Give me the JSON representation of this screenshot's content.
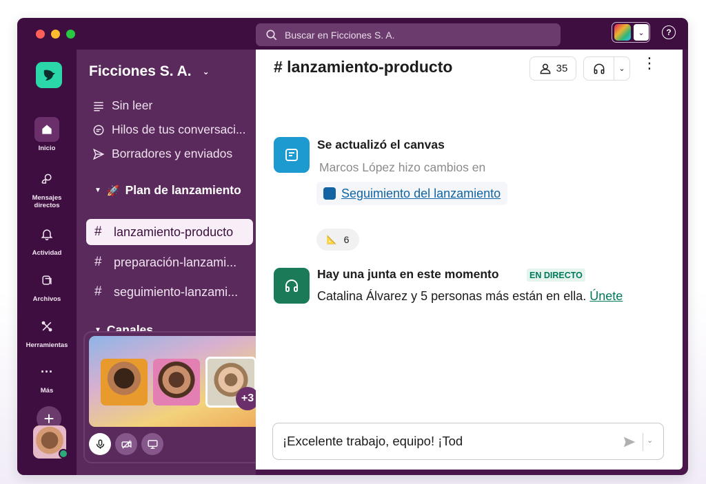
{
  "titlebar": {
    "search_placeholder": "Buscar en Ficciones S. A.",
    "help_label": "?"
  },
  "rail": {
    "items": [
      {
        "label": "Inicio",
        "icon": "home-icon"
      },
      {
        "label": "Mensajes directos",
        "icon": "dm-icon"
      },
      {
        "label": "Actividad",
        "icon": "bell-icon"
      },
      {
        "label": "Archivos",
        "icon": "files-icon"
      },
      {
        "label": "Herramientas",
        "icon": "tools-icon"
      },
      {
        "label": "Más",
        "icon": "more-icon"
      }
    ],
    "add_label": "+"
  },
  "sidebar": {
    "workspace_name": "Ficciones S. A.",
    "nav": [
      {
        "label": "Sin leer",
        "icon": "unread-icon"
      },
      {
        "label": "Hilos de tus conversaci...",
        "icon": "threads-icon"
      },
      {
        "label": "Borradores y enviados",
        "icon": "send-icon"
      }
    ],
    "section_launch": "Plan de lanzamiento",
    "section_launch_emoji": "🚀",
    "channels": [
      {
        "name": "lanzamiento-producto",
        "active": true
      },
      {
        "name": "preparación-lanzami..."
      },
      {
        "name": "seguimiento-lanzami..."
      }
    ],
    "section_channels": "Canales"
  },
  "huddle": {
    "extra_count": "+3"
  },
  "channel": {
    "hash": "#",
    "title": "# lanzamiento-producto",
    "member_count": "35"
  },
  "messages": [
    {
      "title": "Se actualizó el canvas",
      "subtitle": "Marcos López hizo cambios en",
      "link": "Seguimiento del lanzamiento",
      "reaction_emoji": "📐",
      "reaction_count": "6"
    },
    {
      "title": "Hay una junta en este momento",
      "badge": "EN DIRECTO",
      "body": "Catalina Álvarez y 5 personas más están en ella.",
      "join": "Únete"
    }
  ],
  "composer": {
    "text": "¡Excelente trabajo, equipo! ¡Tod"
  },
  "colors": {
    "aubergine": "#4a154b",
    "sidebar": "#5b2a5c",
    "link_blue": "#1264a3",
    "live_green": "#007a5a"
  }
}
